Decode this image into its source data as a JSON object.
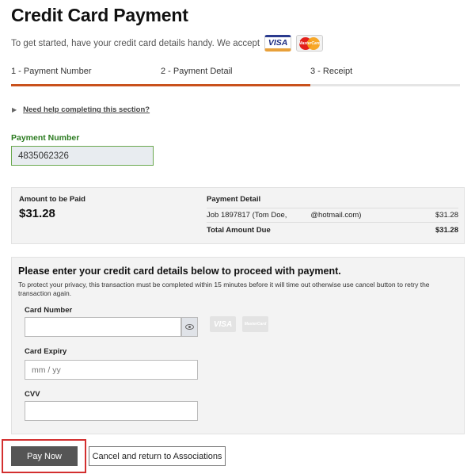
{
  "page": {
    "title": "Credit Card Payment",
    "intro": "To get started, have your credit card details handy. We accept",
    "accepted_cards": {
      "visa": "VISA",
      "mastercard": "MasterCard"
    }
  },
  "steps": [
    {
      "label": "1 - Payment Number",
      "active": true
    },
    {
      "label": "2 - Payment Detail",
      "active": true
    },
    {
      "label": "3 - Receipt",
      "active": false
    }
  ],
  "help": {
    "label": "Need help completing this section?"
  },
  "payment_number": {
    "label": "Payment Number",
    "value": "4835062326"
  },
  "summary": {
    "amount_label": "Amount to be Paid",
    "amount_value": "$31.28",
    "detail_label": "Payment Detail",
    "line_item": {
      "desc_prefix": "Job 1897817 (Tom Doe,",
      "desc_suffix": "@hotmail.com)",
      "amount": "$31.28"
    },
    "total": {
      "label": "Total Amount Due",
      "amount": "$31.28"
    }
  },
  "cc_form": {
    "title": "Please enter your credit card details below to proceed with payment.",
    "note": "To protect your privacy, this transaction must be completed within 15 minutes before it will time out otherwise use cancel button to retry the transaction again.",
    "card_number": {
      "label": "Card Number",
      "value": ""
    },
    "card_expiry": {
      "label": "Card Expiry",
      "placeholder": "mm / yy",
      "value": ""
    },
    "cvv": {
      "label": "CVV",
      "value": ""
    },
    "faded_logos": {
      "visa": "VISA",
      "mastercard": "MasterCard"
    }
  },
  "actions": {
    "pay_now": "Pay Now",
    "cancel": "Cancel and return to Associations"
  },
  "colors": {
    "accent": "#c9511c",
    "label_green": "#2a7a1f",
    "highlight_red": "#d32f2f",
    "pay_button": "#555555"
  }
}
